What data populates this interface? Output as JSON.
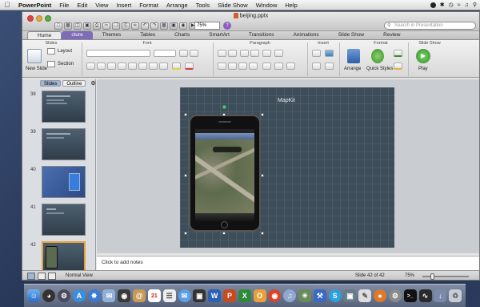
{
  "menubar": {
    "app_name": "PowerPoint",
    "items": [
      "File",
      "Edit",
      "View",
      "Insert",
      "Format",
      "Arrange",
      "Tools",
      "Slide Show",
      "Window",
      "Help"
    ],
    "apple_icon": "apple-logo"
  },
  "window": {
    "title": "beijing.pptx",
    "zoom_value": "75%",
    "search_placeholder": "Search in Presentation"
  },
  "ribbon": {
    "tabs": [
      "Home",
      "Themes",
      "Tables",
      "Charts",
      "SmartArt",
      "Transitions",
      "Animations",
      "Slide Show",
      "Review"
    ],
    "highlight_tab": "cture",
    "groups": {
      "slides": "Slides",
      "font": "Font",
      "paragraph": "Paragraph",
      "insert": "Insert",
      "format": "Format",
      "slide_show": "Slide Show"
    },
    "new_slide_label": "New Slide",
    "layout_label": "Layout",
    "section_label": "Section",
    "arrange_label": "Arrange",
    "quick_styles_label": "Quick Styles",
    "play_label": "Play"
  },
  "left_panel": {
    "tabs": [
      "Slides",
      "Outline"
    ],
    "slide_numbers": [
      "38",
      "39",
      "40",
      "41",
      "42"
    ]
  },
  "slide": {
    "title": "MapKit"
  },
  "notes": {
    "placeholder": "Click to add notes"
  },
  "status": {
    "view_label": "Normal View",
    "slide_counter": "Slide 42 of 42",
    "zoom": "75%"
  },
  "colors": {
    "accent_purple": "#7f6bb8",
    "selection_orange": "#e8a13a",
    "slide_bg": "#3d4d59"
  }
}
